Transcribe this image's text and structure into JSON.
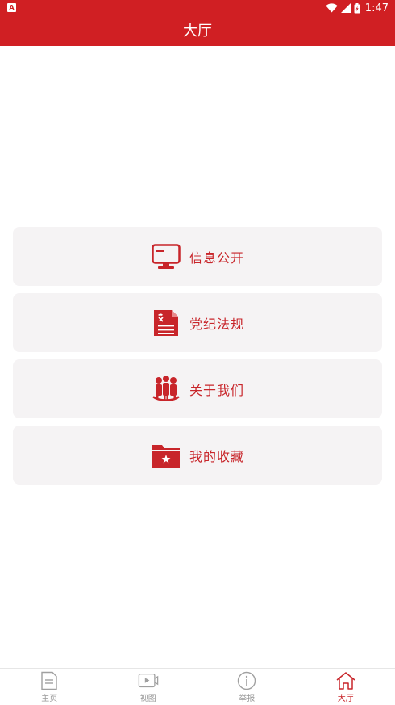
{
  "status_bar": {
    "notification_glyph": "A",
    "time": "1:47",
    "icons": [
      "wifi-icon",
      "cellular-signal-icon",
      "battery-icon"
    ]
  },
  "header": {
    "title": "大厅"
  },
  "menu": {
    "items": [
      {
        "label": "信息公开",
        "icon": "monitor-icon"
      },
      {
        "label": "党纪法规",
        "icon": "party-document-icon"
      },
      {
        "label": "关于我们",
        "icon": "people-group-icon"
      },
      {
        "label": "我的收藏",
        "icon": "star-folder-icon"
      }
    ]
  },
  "tabbar": {
    "tabs": [
      {
        "label": "主页",
        "icon": "document-icon",
        "active": false
      },
      {
        "label": "视图",
        "icon": "video-icon",
        "active": false
      },
      {
        "label": "举报",
        "icon": "info-icon",
        "active": false
      },
      {
        "label": "大厅",
        "icon": "home-icon",
        "active": true
      }
    ]
  },
  "colors": {
    "brand_red": "#d01f23",
    "label_red": "#c8252a",
    "card_bg": "#f5f3f4",
    "tab_inactive": "#9a9a9a"
  }
}
